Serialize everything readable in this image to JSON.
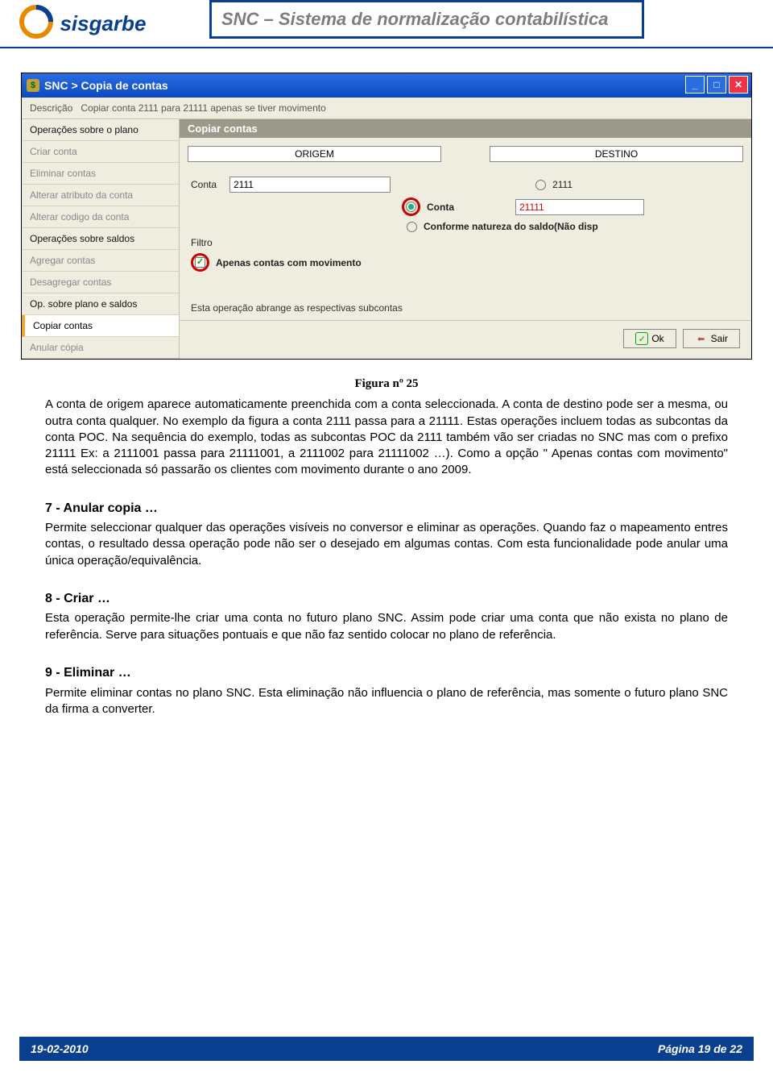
{
  "header": {
    "banner_title": "SNC – Sistema de normalização contabilística",
    "logo_text": "sisgarbe"
  },
  "window": {
    "title": "SNC > Copia de contas",
    "descricao_label": "Descrição",
    "descricao_value": "Copiar conta 2111 para 21111 apenas se tiver movimento",
    "sidebar": {
      "groups": [
        {
          "header": "Operações sobre o plano",
          "items": [
            "Criar conta",
            "Eliminar contas",
            "Alterar atributo da conta",
            "Alterar codigo da conta"
          ]
        },
        {
          "header": "Operações sobre saldos",
          "items": [
            "Agregar contas",
            "Desagregar contas"
          ]
        },
        {
          "header": "Op. sobre plano e saldos",
          "items": [
            "Copiar contas",
            "Anular cópia"
          ]
        }
      ],
      "selected": "Copiar contas"
    },
    "panel": {
      "title": "Copiar contas",
      "col_origem": "ORIGEM",
      "col_destino": "DESTINO",
      "conta_label": "Conta",
      "conta_origem_value": "2111",
      "radio_2111_label": "2111",
      "radio_conta_label": "Conta",
      "conta_destino_value": "21111",
      "radio_natureza_label": "Conforme natureza do saldo(Não disp",
      "filtro_label": "Filtro",
      "checkbox_label": "Apenas contas com movimento",
      "note_text": "Esta operação abrange as respectivas subcontas",
      "btn_ok": "Ok",
      "btn_sair": "Sair"
    }
  },
  "doc": {
    "fig_caption": "Figura nº 25",
    "para1": "A conta de origem aparece automaticamente preenchida com a conta seleccionada. A conta de destino pode ser a mesma, ou outra conta qualquer. No exemplo da figura a conta 2111 passa para a 21111. Estas operações incluem todas as subcontas da conta POC. Na sequência do exemplo, todas as subcontas POC da 2111 também vão ser criadas no SNC mas com o prefixo 21111 Ex: a 2111001 passa para 21111001, a 2111002 para 21111002 …). Como a opção \" Apenas contas com movimento\" está seleccionada só passarão os clientes com movimento durante o ano 2009.",
    "h7": "7 - Anular copia …",
    "para7": "Permite seleccionar qualquer das operações visíveis no conversor e eliminar as operações. Quando faz o mapeamento entres contas, o resultado dessa operação pode não ser o desejado em algumas contas. Com esta funcionalidade pode anular uma única operação/equivalência.",
    "h8": "8 - Criar …",
    "para8": "Esta operação permite-lhe criar uma conta no futuro plano SNC. Assim pode criar uma conta que não exista no plano de referência. Serve para situações pontuais e que não faz sentido colocar no plano de referência.",
    "h9": "9 - Eliminar …",
    "para9": "Permite eliminar contas no plano SNC. Esta eliminação não influencia o plano de referência, mas somente o futuro plano SNC da firma a converter."
  },
  "footer": {
    "date": "19-02-2010",
    "page": "Página 19 de 22"
  }
}
